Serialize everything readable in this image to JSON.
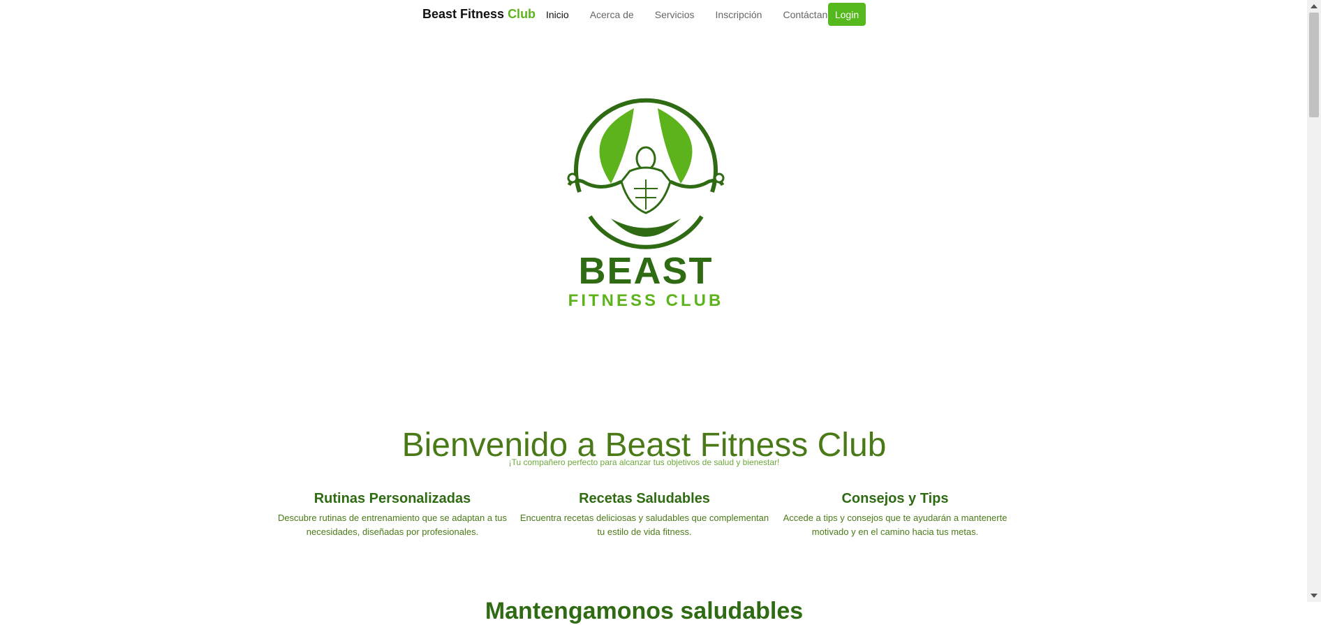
{
  "navbar": {
    "brand_main": "Beast Fitness",
    "brand_accent": "Club",
    "links": [
      "Inicio",
      "Acerca de",
      "Servicios",
      "Inscripción",
      "Contáctanos"
    ],
    "login_label": "Login"
  },
  "logo": {
    "word_big": "BEAST",
    "word_small": "FITNESS CLUB"
  },
  "hero": {
    "title": "Bienvenido a Beast Fitness Club",
    "subtitle": "¡Tu compañero perfecto para alcanzar tus objetivos de salud y bienestar!"
  },
  "features": [
    {
      "title": "Rutinas Personalizadas",
      "text": "Descubre rutinas de entrenamiento que se adaptan a tus necesidades, diseñadas por profesionales."
    },
    {
      "title": "Recetas Saludables",
      "text": "Encuentra recetas deliciosas y saludables que complementan tu estilo de vida fitness."
    },
    {
      "title": "Consejos y Tips",
      "text": "Accede a tips y consejos que te ayudarán a mantenerte motivado y en el camino hacia tus metas."
    }
  ],
  "section_title": "Mantengamonos saludables",
  "colors": {
    "brand_green": "#5cb31c",
    "dark_green": "#2e6b12",
    "login_bg": "#55b81d"
  }
}
